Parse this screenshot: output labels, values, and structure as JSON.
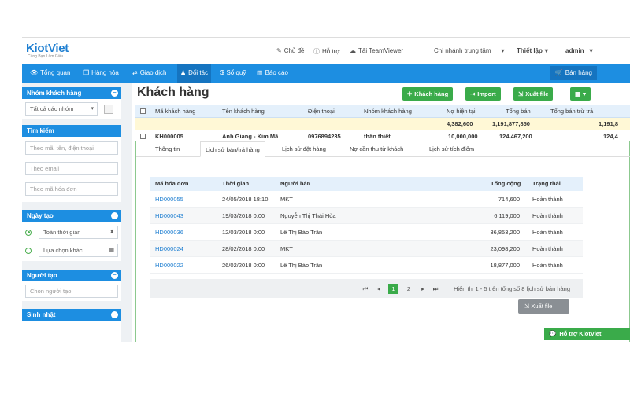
{
  "brand": {
    "name_a": "Kiot",
    "name_b": "Viet",
    "tagline": "Cùng Bạn Làm Giàu"
  },
  "topnav": {
    "theme": "Chủ đề",
    "support": "Hỗ trợ",
    "teamviewer": "Tải TeamViewer",
    "branch": "Chi nhánh trung tâm",
    "settings": "Thiết lập",
    "user": "admin"
  },
  "nav": {
    "items": [
      "Tổng quan",
      "Hàng hóa",
      "Giao dịch",
      "Đối tác",
      "Sổ quỹ",
      "Báo cáo"
    ],
    "sale_button": "Bán hàng"
  },
  "sidebar": {
    "group_title": "Nhóm khách hàng",
    "group_select": "Tất cả các nhóm",
    "search_title": "Tìm kiếm",
    "search_placeholders": [
      "Theo mã, tên, điện thoại",
      "Theo email",
      "Theo mã hóa đơn"
    ],
    "created_date_title": "Ngày tạo",
    "date_options": [
      "Toàn thời gian",
      "Lựa chọn khác"
    ],
    "creator_title": "Người tạo",
    "creator_placeholder": "Chọn người tạo",
    "birthday_title": "Sinh nhật"
  },
  "main": {
    "title": "Khách hàng",
    "buttons": {
      "add": "Khách hàng",
      "import": "Import",
      "export": "Xuất file"
    },
    "columns": [
      "Mã khách hàng",
      "Tên khách hàng",
      "Điện thoại",
      "Nhóm khách hàng",
      "Nợ hiện tại",
      "Tổng bán",
      "Tổng bán trừ trả"
    ],
    "summary": {
      "debt": "4,382,600",
      "total": "1,191,877,850",
      "net": "1,191,8"
    },
    "customer": {
      "code": "KH000005",
      "name": "Anh Giang - Kim Mã",
      "phone": "0976894235",
      "group": "thân thiết",
      "debt": "10,000,000",
      "total": "124,467,200",
      "net": "124,4"
    },
    "tabs": [
      "Thông tin",
      "Lịch sử bán/trả hàng",
      "Lịch sử đặt hàng",
      "Nợ cần thu từ khách",
      "Lịch sử tích điểm"
    ],
    "history": {
      "columns": [
        "Mã hóa đơn",
        "Thời gian",
        "Người bán",
        "Tổng cộng",
        "Trạng thái"
      ],
      "rows": [
        {
          "code": "HD000055",
          "time": "24/05/2018 18:10",
          "seller": "MKT",
          "total": "714,600",
          "status": "Hoàn thành"
        },
        {
          "code": "HD000043",
          "time": "19/03/2018 0:00",
          "seller": "Nguyễn Thị Thái Hòa",
          "total": "6,119,000",
          "status": "Hoàn thành"
        },
        {
          "code": "HD000036",
          "time": "12/03/2018 0:00",
          "seller": "Lê Thị Bảo Trân",
          "total": "36,853,200",
          "status": "Hoàn thành"
        },
        {
          "code": "HD000024",
          "time": "28/02/2018 0:00",
          "seller": "MKT",
          "total": "23,098,200",
          "status": "Hoàn thành"
        },
        {
          "code": "HD000022",
          "time": "26/02/2018 0:00",
          "seller": "Lê Thị Bảo Trân",
          "total": "18,877,000",
          "status": "Hoàn thành"
        }
      ],
      "pagination": {
        "first": "⏮",
        "prev": "◂",
        "pages": [
          "1",
          "2"
        ],
        "next": "▸",
        "last": "⏭",
        "info": "Hiển thị 1 - 5 trên tổng số 8 lịch sử bán hàng"
      },
      "export_button": "Xuất file"
    }
  },
  "support_widget": "Hỗ trợ KiotViet",
  "colors": {
    "primary": "#1d8ee1",
    "primary_dark": "#1574c0",
    "green": "#3aab4a",
    "summary_bg": "#fff8d6"
  }
}
